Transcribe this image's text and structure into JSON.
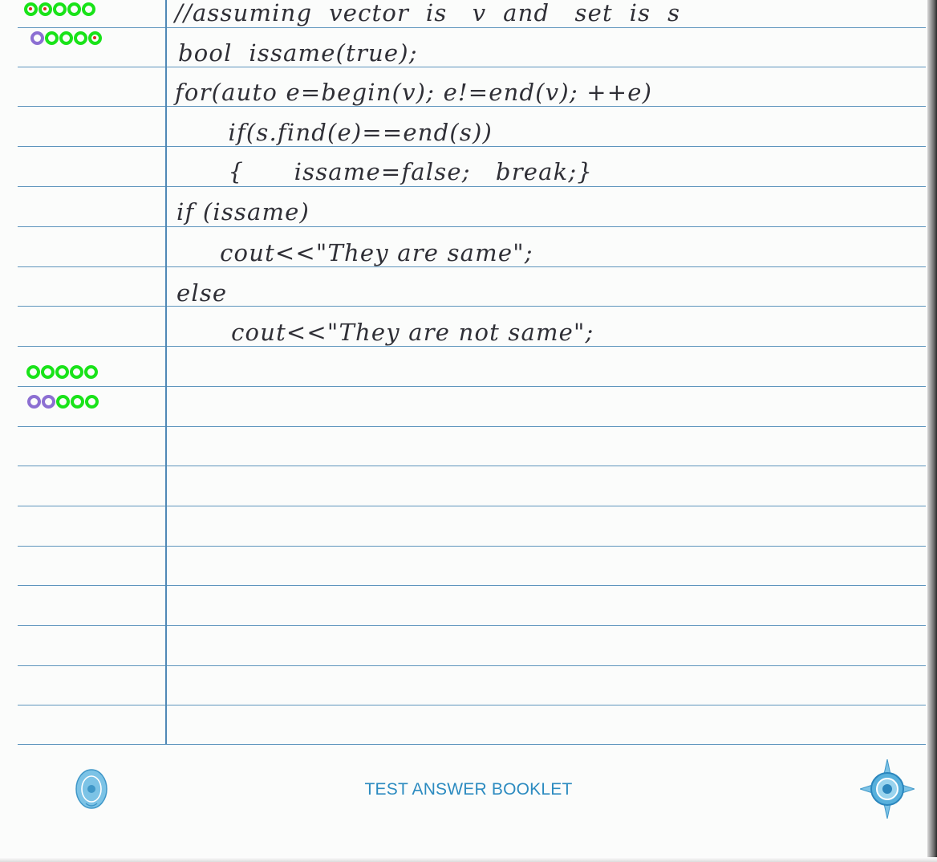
{
  "answer": {
    "lines": [
      "//assuming  vector  is   v  and   set  is  s",
      "bool  issame(true);",
      "for(auto e=begin(v); e!=end(v); ++e)",
      "      if(s.find(e)==end(s))",
      "      {      issame=false;   break;}",
      "if (issame)",
      "     cout<<\"They are same\";",
      "else",
      "     cout<<\"They are not same\";"
    ]
  },
  "footer": {
    "title": "TEST ANSWER BOOKLET"
  },
  "colors": {
    "rule": "#5e95bd",
    "margin": "#4f89b6",
    "ink": "#2f2f36",
    "mark_ring": "#19e319",
    "mark_dot": "#e0261f",
    "footer_text": "#2c8bc0"
  },
  "icons": {
    "left_seal": "emblem-seal-icon",
    "right_seal": "compass-rose-seal-icon"
  }
}
